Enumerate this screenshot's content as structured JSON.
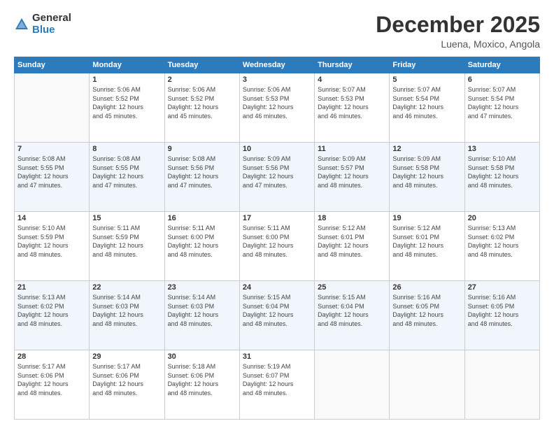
{
  "logo": {
    "general": "General",
    "blue": "Blue"
  },
  "header": {
    "month": "December 2025",
    "location": "Luena, Moxico, Angola"
  },
  "weekdays": [
    "Sunday",
    "Monday",
    "Tuesday",
    "Wednesday",
    "Thursday",
    "Friday",
    "Saturday"
  ],
  "weeks": [
    [
      {
        "day": "",
        "info": ""
      },
      {
        "day": "1",
        "info": "Sunrise: 5:06 AM\nSunset: 5:52 PM\nDaylight: 12 hours\nand 45 minutes."
      },
      {
        "day": "2",
        "info": "Sunrise: 5:06 AM\nSunset: 5:52 PM\nDaylight: 12 hours\nand 45 minutes."
      },
      {
        "day": "3",
        "info": "Sunrise: 5:06 AM\nSunset: 5:53 PM\nDaylight: 12 hours\nand 46 minutes."
      },
      {
        "day": "4",
        "info": "Sunrise: 5:07 AM\nSunset: 5:53 PM\nDaylight: 12 hours\nand 46 minutes."
      },
      {
        "day": "5",
        "info": "Sunrise: 5:07 AM\nSunset: 5:54 PM\nDaylight: 12 hours\nand 46 minutes."
      },
      {
        "day": "6",
        "info": "Sunrise: 5:07 AM\nSunset: 5:54 PM\nDaylight: 12 hours\nand 47 minutes."
      }
    ],
    [
      {
        "day": "7",
        "info": "Sunrise: 5:08 AM\nSunset: 5:55 PM\nDaylight: 12 hours\nand 47 minutes."
      },
      {
        "day": "8",
        "info": "Sunrise: 5:08 AM\nSunset: 5:55 PM\nDaylight: 12 hours\nand 47 minutes."
      },
      {
        "day": "9",
        "info": "Sunrise: 5:08 AM\nSunset: 5:56 PM\nDaylight: 12 hours\nand 47 minutes."
      },
      {
        "day": "10",
        "info": "Sunrise: 5:09 AM\nSunset: 5:56 PM\nDaylight: 12 hours\nand 47 minutes."
      },
      {
        "day": "11",
        "info": "Sunrise: 5:09 AM\nSunset: 5:57 PM\nDaylight: 12 hours\nand 48 minutes."
      },
      {
        "day": "12",
        "info": "Sunrise: 5:09 AM\nSunset: 5:58 PM\nDaylight: 12 hours\nand 48 minutes."
      },
      {
        "day": "13",
        "info": "Sunrise: 5:10 AM\nSunset: 5:58 PM\nDaylight: 12 hours\nand 48 minutes."
      }
    ],
    [
      {
        "day": "14",
        "info": "Sunrise: 5:10 AM\nSunset: 5:59 PM\nDaylight: 12 hours\nand 48 minutes."
      },
      {
        "day": "15",
        "info": "Sunrise: 5:11 AM\nSunset: 5:59 PM\nDaylight: 12 hours\nand 48 minutes."
      },
      {
        "day": "16",
        "info": "Sunrise: 5:11 AM\nSunset: 6:00 PM\nDaylight: 12 hours\nand 48 minutes."
      },
      {
        "day": "17",
        "info": "Sunrise: 5:11 AM\nSunset: 6:00 PM\nDaylight: 12 hours\nand 48 minutes."
      },
      {
        "day": "18",
        "info": "Sunrise: 5:12 AM\nSunset: 6:01 PM\nDaylight: 12 hours\nand 48 minutes."
      },
      {
        "day": "19",
        "info": "Sunrise: 5:12 AM\nSunset: 6:01 PM\nDaylight: 12 hours\nand 48 minutes."
      },
      {
        "day": "20",
        "info": "Sunrise: 5:13 AM\nSunset: 6:02 PM\nDaylight: 12 hours\nand 48 minutes."
      }
    ],
    [
      {
        "day": "21",
        "info": "Sunrise: 5:13 AM\nSunset: 6:02 PM\nDaylight: 12 hours\nand 48 minutes."
      },
      {
        "day": "22",
        "info": "Sunrise: 5:14 AM\nSunset: 6:03 PM\nDaylight: 12 hours\nand 48 minutes."
      },
      {
        "day": "23",
        "info": "Sunrise: 5:14 AM\nSunset: 6:03 PM\nDaylight: 12 hours\nand 48 minutes."
      },
      {
        "day": "24",
        "info": "Sunrise: 5:15 AM\nSunset: 6:04 PM\nDaylight: 12 hours\nand 48 minutes."
      },
      {
        "day": "25",
        "info": "Sunrise: 5:15 AM\nSunset: 6:04 PM\nDaylight: 12 hours\nand 48 minutes."
      },
      {
        "day": "26",
        "info": "Sunrise: 5:16 AM\nSunset: 6:05 PM\nDaylight: 12 hours\nand 48 minutes."
      },
      {
        "day": "27",
        "info": "Sunrise: 5:16 AM\nSunset: 6:05 PM\nDaylight: 12 hours\nand 48 minutes."
      }
    ],
    [
      {
        "day": "28",
        "info": "Sunrise: 5:17 AM\nSunset: 6:06 PM\nDaylight: 12 hours\nand 48 minutes."
      },
      {
        "day": "29",
        "info": "Sunrise: 5:17 AM\nSunset: 6:06 PM\nDaylight: 12 hours\nand 48 minutes."
      },
      {
        "day": "30",
        "info": "Sunrise: 5:18 AM\nSunset: 6:06 PM\nDaylight: 12 hours\nand 48 minutes."
      },
      {
        "day": "31",
        "info": "Sunrise: 5:19 AM\nSunset: 6:07 PM\nDaylight: 12 hours\nand 48 minutes."
      },
      {
        "day": "",
        "info": ""
      },
      {
        "day": "",
        "info": ""
      },
      {
        "day": "",
        "info": ""
      }
    ]
  ]
}
